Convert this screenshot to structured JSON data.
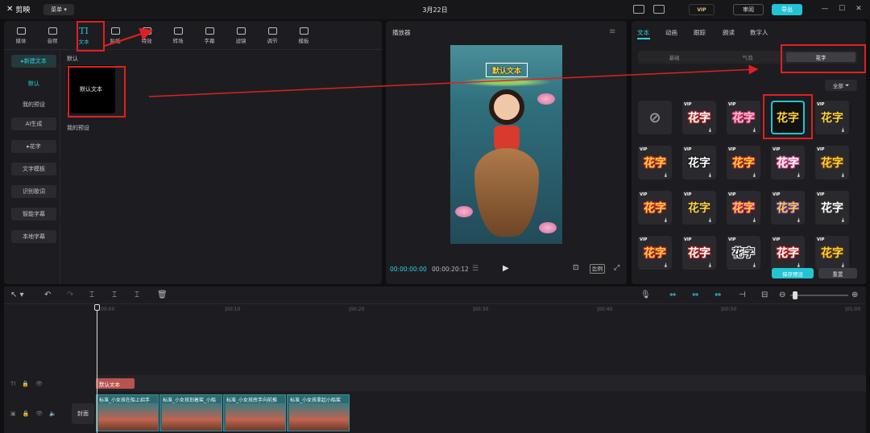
{
  "titlebar": {
    "app_name": "剪映",
    "menu_label": "菜单",
    "title": "3月22日",
    "vip_label": "VIP",
    "review_label": "审阅",
    "export_label": "导出"
  },
  "left_tabs": [
    {
      "label": "媒体",
      "icon": "media-icon"
    },
    {
      "label": "音频",
      "icon": "audio-icon"
    },
    {
      "label": "文本",
      "icon": "text-icon",
      "glyph": "TI"
    },
    {
      "label": "贴纸",
      "icon": "sticker-icon"
    },
    {
      "label": "特效",
      "icon": "effects-icon"
    },
    {
      "label": "转场",
      "icon": "transition-icon"
    },
    {
      "label": "字幕",
      "icon": "subtitle-icon"
    },
    {
      "label": "滤镜",
      "icon": "filter-icon"
    },
    {
      "label": "调节",
      "icon": "adjust-icon"
    },
    {
      "label": "模板",
      "icon": "template-icon"
    }
  ],
  "left_nav": [
    {
      "label": "新建文本",
      "state": "active"
    },
    {
      "label": "默认",
      "state": "selected"
    },
    {
      "label": "我的预设",
      "state": "plain"
    },
    {
      "label": "AI生成",
      "state": "boxed"
    },
    {
      "label": "花字",
      "state": "boxed"
    },
    {
      "label": "文字模板",
      "state": "boxed"
    },
    {
      "label": "识别歌词",
      "state": "boxed"
    },
    {
      "label": "智能字幕",
      "state": "boxed"
    },
    {
      "label": "本地字幕",
      "state": "boxed"
    }
  ],
  "content": {
    "section_default": "默认",
    "default_card_label": "默认文本",
    "section_presets": "我的预设"
  },
  "player": {
    "title": "播放器",
    "overlay_text": "默认文本",
    "current_time": "00:00:00:00",
    "total_time": "00:00:20:12",
    "ratio_label": "比例"
  },
  "right_tabs": [
    "文本",
    "动画",
    "跟踪",
    "朗读",
    "数字人"
  ],
  "right_segments": [
    "基础",
    "气泡",
    "花字"
  ],
  "right_filter": "全部",
  "flower_text_grid": [
    [
      "none",
      "花字",
      "花字",
      "花字",
      "花字"
    ],
    [
      "花字",
      "花字",
      "花字",
      "花字",
      "花字"
    ],
    [
      "花字",
      "花字",
      "花字",
      "花字",
      "花字"
    ],
    [
      "花字",
      "花字",
      "花字",
      "花字",
      "花字"
    ]
  ],
  "right_buttons": {
    "save_preset": "保存预设",
    "reset": "重置"
  },
  "timeline": {
    "ticks": [
      "00:00",
      "|00:10",
      "|00:20",
      "|00:30",
      "|00:40",
      "|00:50",
      "|01:00"
    ],
    "text_clip": "默认文本",
    "cover_label": "封面",
    "video_clips": [
      "标准_小女孩在船上招手",
      "标准_小女孩划着桨_小船",
      "标准_小女孩挥手向前推",
      "标准_小女孩拿起小船桨"
    ]
  },
  "colors": {
    "accent": "#22c4d4",
    "highlight_box": "#e02020",
    "text_clip": "#b8534f"
  }
}
